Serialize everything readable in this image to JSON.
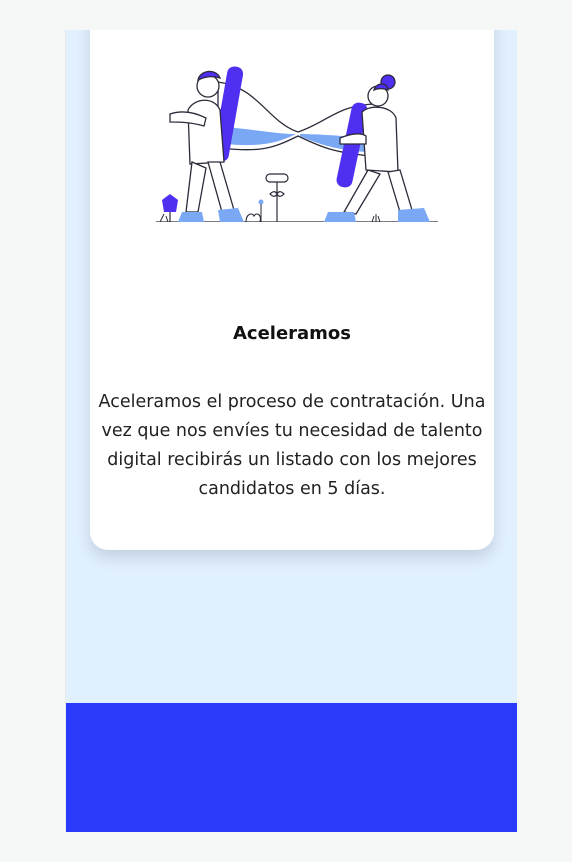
{
  "card": {
    "title": "Aceleramos",
    "body": "Aceleramos el proceso de contratación. Una vez que nos envíes tu necesidad de talento digital recibirás un listado con los mejores candidatos en 5 días."
  },
  "colors": {
    "page_bg": "#f6f7f7",
    "section_bg": "#e1f0fd",
    "card_bg": "#ffffff",
    "accent_purple": "#4f2ff0",
    "accent_blue": "#7aa8f5",
    "footer_blue": "#2a3af9"
  },
  "illustration": {
    "icon": "hourglass-teamwork-illustration"
  }
}
